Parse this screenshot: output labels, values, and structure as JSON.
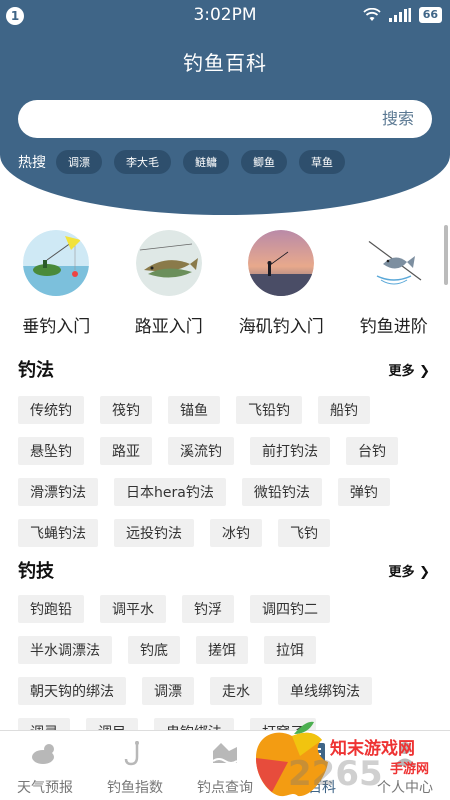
{
  "status": {
    "notif": "1",
    "time": "3:02PM",
    "battery": "66"
  },
  "app_title": "钓鱼百科",
  "search": {
    "placeholder": "",
    "button": "搜索"
  },
  "hot": {
    "label": "热搜",
    "tags": [
      "调漂",
      "李大毛",
      "鲢鳙",
      "鲫鱼",
      "草鱼"
    ]
  },
  "categories": [
    "垂钓入门",
    "路亚入门",
    "海矶钓入门",
    "钓鱼进阶"
  ],
  "sections": [
    {
      "title": "钓法",
      "more": "更多",
      "rows": [
        [
          "传统钓",
          "筏钓",
          "锚鱼",
          "飞铅钓",
          "船钓"
        ],
        [
          "悬坠钓",
          "路亚",
          "溪流钓",
          "前打钓法",
          "台钓"
        ],
        [
          "滑漂钓法",
          "日本hera钓法",
          "微铅钓法",
          "弹钓"
        ],
        [
          "飞蝇钓法",
          "远投钓法",
          "冰钓",
          "飞钓"
        ]
      ]
    },
    {
      "title": "钓技",
      "more": "更多",
      "rows": [
        [
          "钓跑铅",
          "调平水",
          "钓浮",
          "调四钓二"
        ],
        [
          "半水调漂法",
          "钓底",
          "搓饵",
          "拉饵"
        ],
        [
          "朝天钩的绑法",
          "调漂",
          "走水",
          "单线绑钩法"
        ],
        [
          "调灵",
          "调目",
          "串钩绑法",
          "打窝子"
        ]
      ]
    }
  ],
  "tabs": [
    "天气预报",
    "钓鱼指数",
    "钓点查询",
    "鱼百科",
    "个人中心"
  ],
  "watermark": {
    "line1": "知末游戏网",
    "line2": "2265",
    "line3": "手游网"
  },
  "colors": {
    "header": "#3f6587",
    "hot_tag": "#2e4f6d",
    "tag_bg": "#f0f0f0",
    "watermark": "#e33333"
  }
}
